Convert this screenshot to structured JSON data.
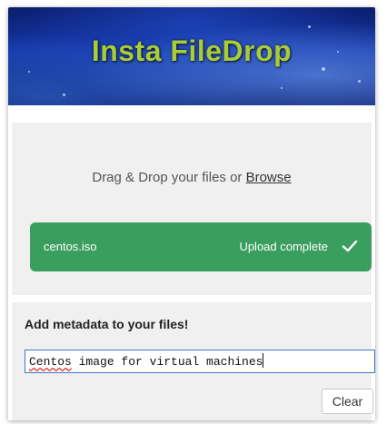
{
  "header": {
    "title": "Insta FileDrop"
  },
  "dropzone": {
    "prompt": "Drag & Drop your files or ",
    "browse_link": "Browse"
  },
  "file": {
    "name": "centos.iso",
    "status": "Upload complete",
    "status_icon": "check-icon",
    "bar_color": "#3a9e5e"
  },
  "metadata": {
    "title": "Add metadata to your files!",
    "input_value_misspelled": "Centos",
    "input_value_rest": " image for virtual machines",
    "clear_label": "Clear"
  },
  "colors": {
    "title_color": "#a8cc3a",
    "header_blue": "#1436a8",
    "panel_bg": "#f0f0f0",
    "focus_border": "#3b78c7"
  }
}
